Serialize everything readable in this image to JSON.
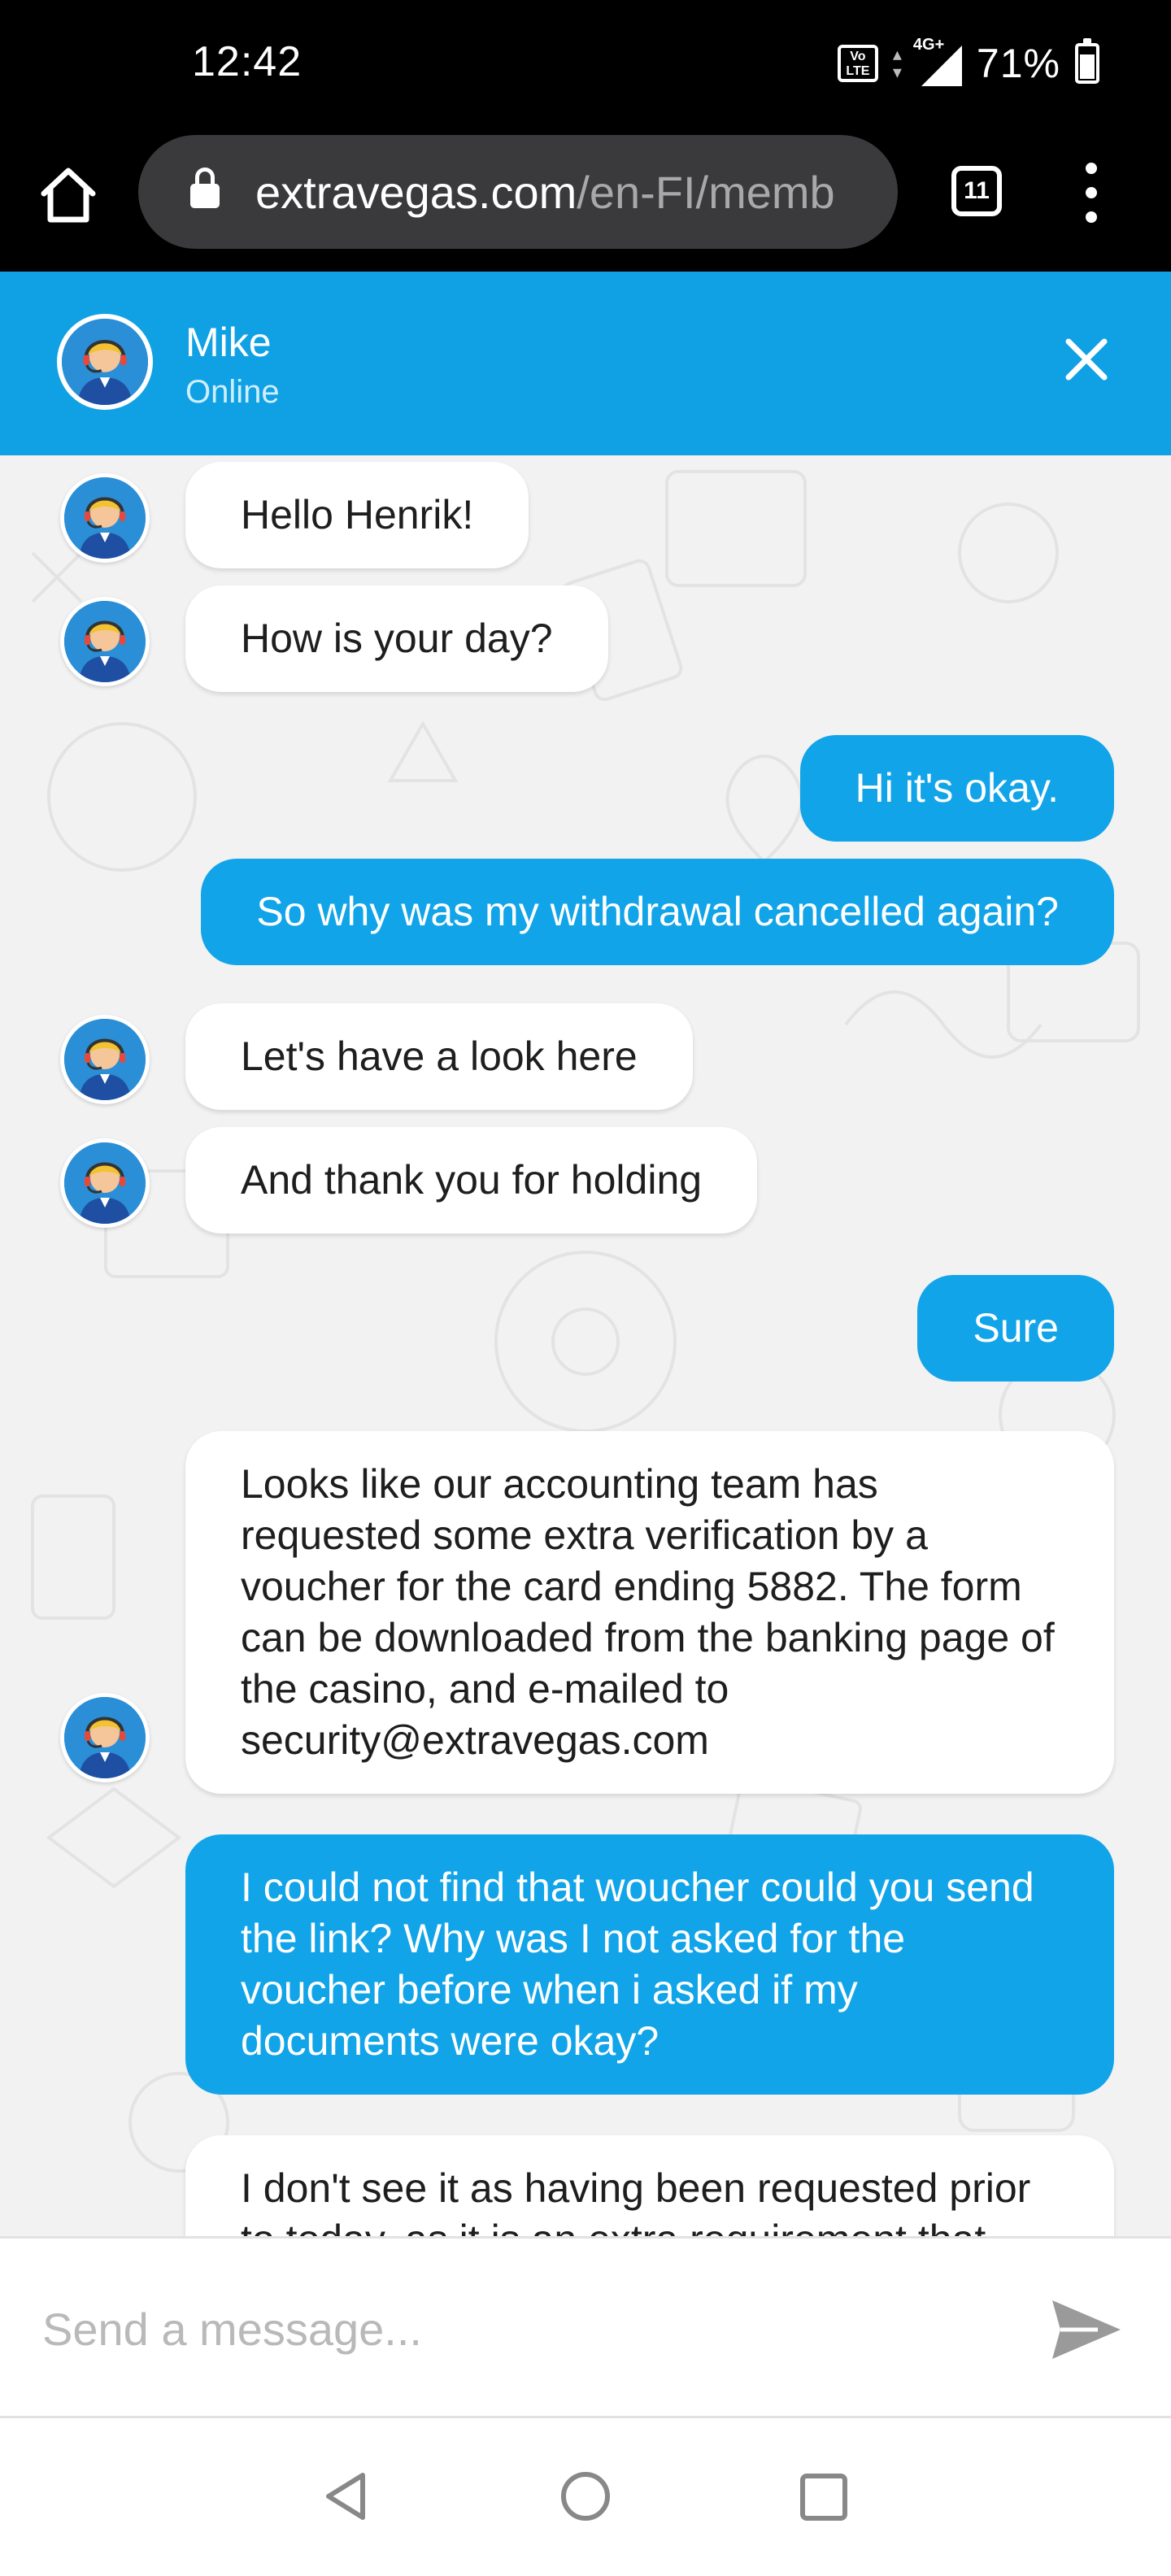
{
  "status_bar": {
    "time": "12:42",
    "volte": "Vo)\nLTE",
    "network": "4G+",
    "battery": "71%",
    "battery_level": 0.71
  },
  "browser": {
    "url_domain": "extravegas.com",
    "url_path": "/en-FI/memb",
    "tab_count": "11"
  },
  "chat_header": {
    "agent_name": "Mike",
    "agent_status": "Online"
  },
  "messages": [
    {
      "from": "agent",
      "text": "Hello Henrik!"
    },
    {
      "from": "agent",
      "text": "How is your day?"
    },
    {
      "from": "user",
      "text": "Hi it's okay."
    },
    {
      "from": "user",
      "text": "So why was my withdrawal cancelled again?"
    },
    {
      "from": "agent",
      "text": "Let's have a look here"
    },
    {
      "from": "agent",
      "text": "And thank you for holding"
    },
    {
      "from": "user",
      "text": "Sure"
    },
    {
      "from": "agent",
      "text": "Looks like our accounting team has requested some extra verification by a voucher for the card ending 5882. The form can be downloaded from the banking page of the casino, and e-mailed to security@extravegas.com"
    },
    {
      "from": "user",
      "text": "I could not find that woucher could you send the link? Why was I not asked for the voucher before when i asked if my documents were okay?"
    },
    {
      "from": "agent",
      "text": "I don't see it as having been requested prior to today, as it is an extra requirement that might"
    }
  ],
  "input": {
    "placeholder": "Send a message..."
  },
  "colors": {
    "header_blue": "#10a1e4",
    "user_bubble": "#12a4e8",
    "agent_bubble": "#ffffff",
    "chat_background": "#f2f2f2"
  },
  "icons": [
    "home-icon",
    "lock-icon",
    "tabs-icon",
    "more-vert-icon",
    "close-icon",
    "agent-avatar-icon",
    "send-icon",
    "nav-back-icon",
    "nav-home-icon",
    "nav-recents-icon"
  ]
}
